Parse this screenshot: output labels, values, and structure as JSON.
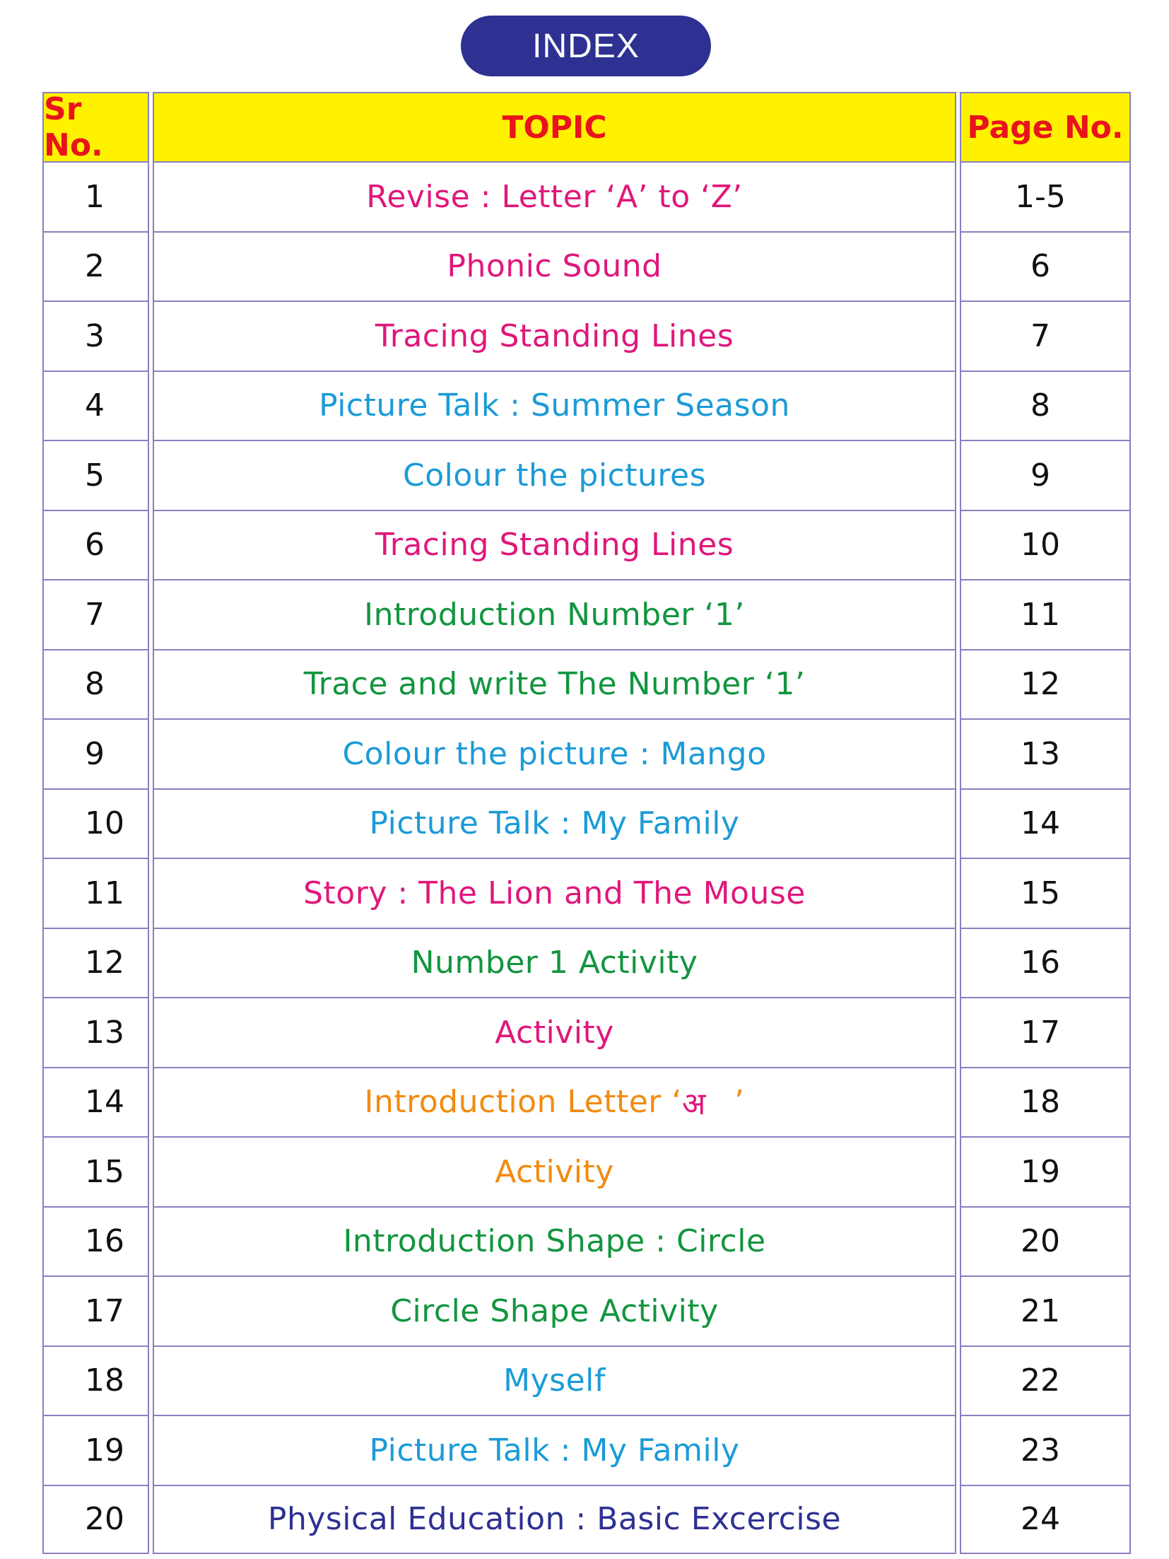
{
  "title": "INDEX",
  "headers": {
    "sr": "Sr No.",
    "topic": "TOPIC",
    "page": "Page No."
  },
  "colors": {
    "pill": "#2e3192",
    "header_bg": "#fff200",
    "header_text": "#e8141c",
    "grid": "#8a7fc0",
    "pink": "#e0177a",
    "blue": "#1b9bd7",
    "green": "#12953f",
    "orange": "#f38a0f",
    "navy": "#2e3192"
  },
  "rows": [
    {
      "sr": "1",
      "topic": "Revise : Letter ‘A’ to ‘Z’",
      "page": "1-5",
      "color": "#e0177a"
    },
    {
      "sr": "2",
      "topic": "Phonic Sound",
      "page": "6",
      "color": "#e0177a"
    },
    {
      "sr": "3",
      "topic": "Tracing Standing Lines",
      "page": "7",
      "color": "#e0177a"
    },
    {
      "sr": "4",
      "topic": "Picture Talk : Summer Season",
      "page": "8",
      "color": "#1b9bd7"
    },
    {
      "sr": "5",
      "topic": "Colour the pictures",
      "page": "9",
      "color": "#1b9bd7"
    },
    {
      "sr": "6",
      "topic": "Tracing Standing Lines",
      "page": "10",
      "color": "#e0177a"
    },
    {
      "sr": "7",
      "topic": "Introduction Number ‘1’",
      "page": "11",
      "color": "#12953f"
    },
    {
      "sr": "8",
      "topic": "Trace and write The Number ‘1’",
      "page": "12",
      "color": "#12953f"
    },
    {
      "sr": "9",
      "topic": "Colour the picture : Mango",
      "page": "13",
      "color": "#1b9bd7"
    },
    {
      "sr": "10",
      "topic": "Picture Talk : My Family",
      "page": "14",
      "color": "#1b9bd7"
    },
    {
      "sr": "11",
      "topic": "Story : The Lion and The Mouse",
      "page": "15",
      "color": "#e0177a"
    },
    {
      "sr": "12",
      "topic": "Number 1 Activity",
      "page": "16",
      "color": "#12953f"
    },
    {
      "sr": "13",
      "topic": "Activity",
      "page": "17",
      "color": "#e0177a"
    },
    {
      "sr": "14",
      "topic": "Introduction Letter ‘",
      "topic_deva": "अ",
      "topic_end": "’",
      "page": "18",
      "color": "#f38a0f",
      "deva_color": "#e0177a"
    },
    {
      "sr": "15",
      "topic": "Activity",
      "page": "19",
      "color": "#f38a0f"
    },
    {
      "sr": "16",
      "topic": "Introduction Shape : Circle",
      "page": "20",
      "color": "#12953f"
    },
    {
      "sr": "17",
      "topic": "Circle Shape Activity",
      "page": "21",
      "color": "#12953f"
    },
    {
      "sr": "18",
      "topic": "Myself",
      "page": "22",
      "color": "#1b9bd7"
    },
    {
      "sr": "19",
      "topic": "Picture Talk : My Family",
      "page": "23",
      "color": "#1b9bd7"
    },
    {
      "sr": "20",
      "topic": "Physical Education : Basic Excercise",
      "page": "24",
      "color": "#2e3192"
    }
  ]
}
